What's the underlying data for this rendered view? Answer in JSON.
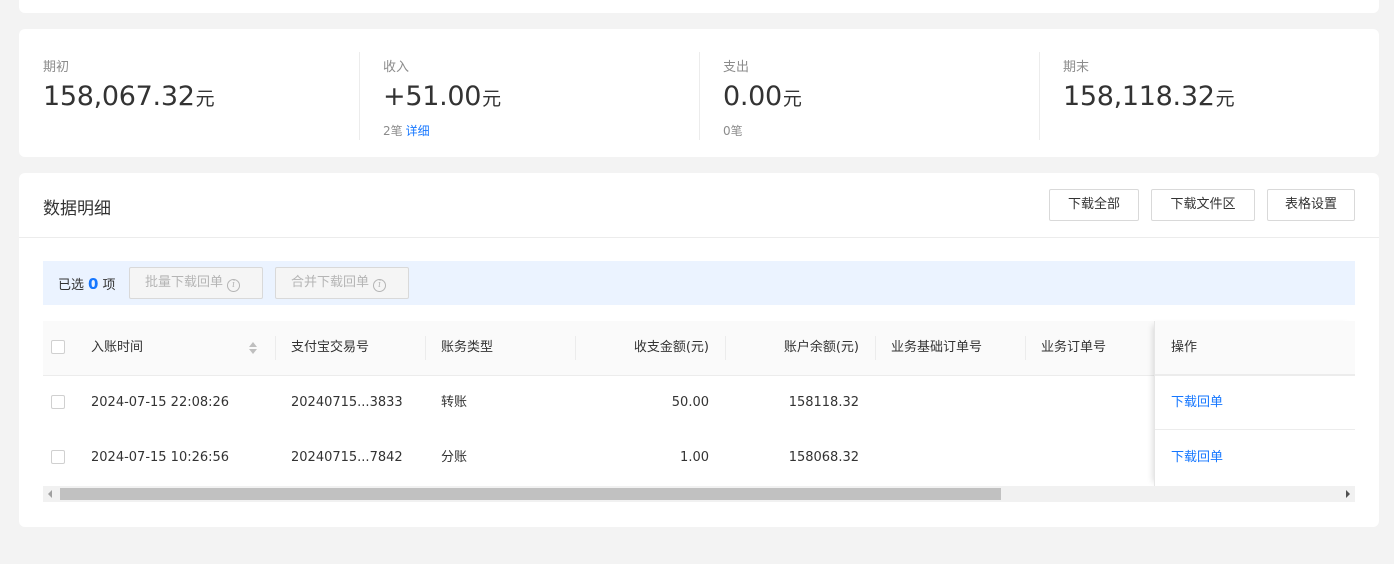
{
  "summary": {
    "opening": {
      "label": "期初",
      "value": "158,067.32",
      "unit": "元"
    },
    "income": {
      "label": "收入",
      "value": "+51.00",
      "unit": "元",
      "count": "2笔",
      "detail_link": "详细"
    },
    "expense": {
      "label": "支出",
      "value": "0.00",
      "unit": "元",
      "count": "0笔"
    },
    "closing": {
      "label": "期末",
      "value": "158,118.32",
      "unit": "元"
    }
  },
  "detail": {
    "title": "数据明细",
    "buttons": {
      "download_all": "下载全部",
      "download_area": "下载文件区",
      "table_settings": "表格设置"
    },
    "selection": {
      "prefix": "已选",
      "count": "0",
      "suffix": "项",
      "batch_download": "批量下载回单",
      "merge_download": "合并下载回单"
    }
  },
  "table": {
    "columns": {
      "time": "入账时间",
      "trade_no": "支付宝交易号",
      "type": "账务类型",
      "amount": "收支金额(元)",
      "balance": "账户余额(元)",
      "base_order": "业务基础订单号",
      "order": "业务订单号",
      "ops": "操作"
    },
    "rows": [
      {
        "time": "2024-07-15 22:08:26",
        "trade_no": "20240715...3833",
        "type": "转账",
        "amount": "50.00",
        "balance": "158118.32",
        "base_order": "",
        "order": "",
        "action": "下载回单"
      },
      {
        "time": "2024-07-15 10:26:56",
        "trade_no": "20240715...7842",
        "type": "分账",
        "amount": "1.00",
        "balance": "158068.32",
        "base_order": "",
        "order": "",
        "action": "下载回单"
      }
    ]
  },
  "colors": {
    "accent": "#1677ff",
    "selection_bg": "#ebf3ff",
    "page_bg": "#f3f3f3"
  }
}
